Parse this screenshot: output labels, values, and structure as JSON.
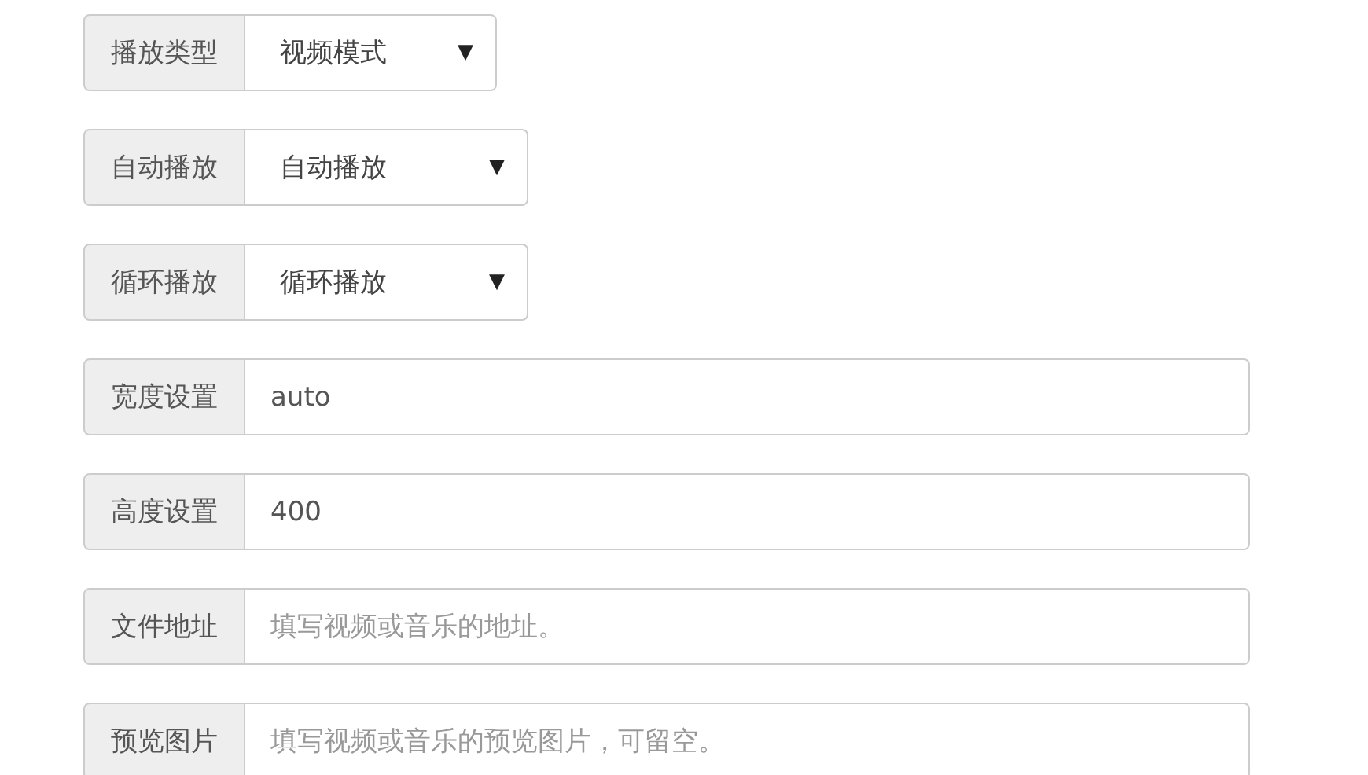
{
  "fields": [
    {
      "kind": "select",
      "label": "播放类型",
      "value": "视频模式",
      "caret": "▼"
    },
    {
      "kind": "select",
      "label": "自动播放",
      "value": "自动播放",
      "caret": "▼"
    },
    {
      "kind": "select",
      "label": "循环播放",
      "value": "循环播放",
      "caret": "▼"
    },
    {
      "kind": "input",
      "label": "宽度设置",
      "value": "auto"
    },
    {
      "kind": "input",
      "label": "高度设置",
      "value": "400"
    },
    {
      "kind": "input",
      "label": "文件地址",
      "placeholder": "填写视频或音乐的地址。"
    },
    {
      "kind": "input",
      "label": "预览图片",
      "placeholder": "填写视频或音乐的预览图片，可留空。"
    }
  ]
}
